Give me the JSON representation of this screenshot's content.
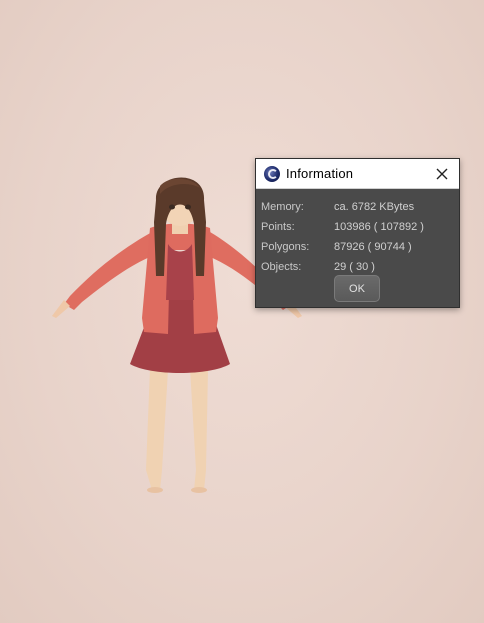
{
  "dialog": {
    "title": "Information",
    "icon": "cinema4d-app-icon",
    "rows": [
      {
        "label": "Memory:",
        "value": "ca. 6782 KBytes"
      },
      {
        "label": "Points:",
        "value": "103986 ( 107892 )"
      },
      {
        "label": "Polygons:",
        "value": "87926 ( 90744 )"
      },
      {
        "label": "Objects:",
        "value": "29 ( 30 )"
      }
    ],
    "ok_label": "OK"
  },
  "colors": {
    "background": "#ead6ce",
    "dialog_body": "#4a4a4a",
    "jacket": "#d8665c",
    "dress": "#9e3b42"
  }
}
